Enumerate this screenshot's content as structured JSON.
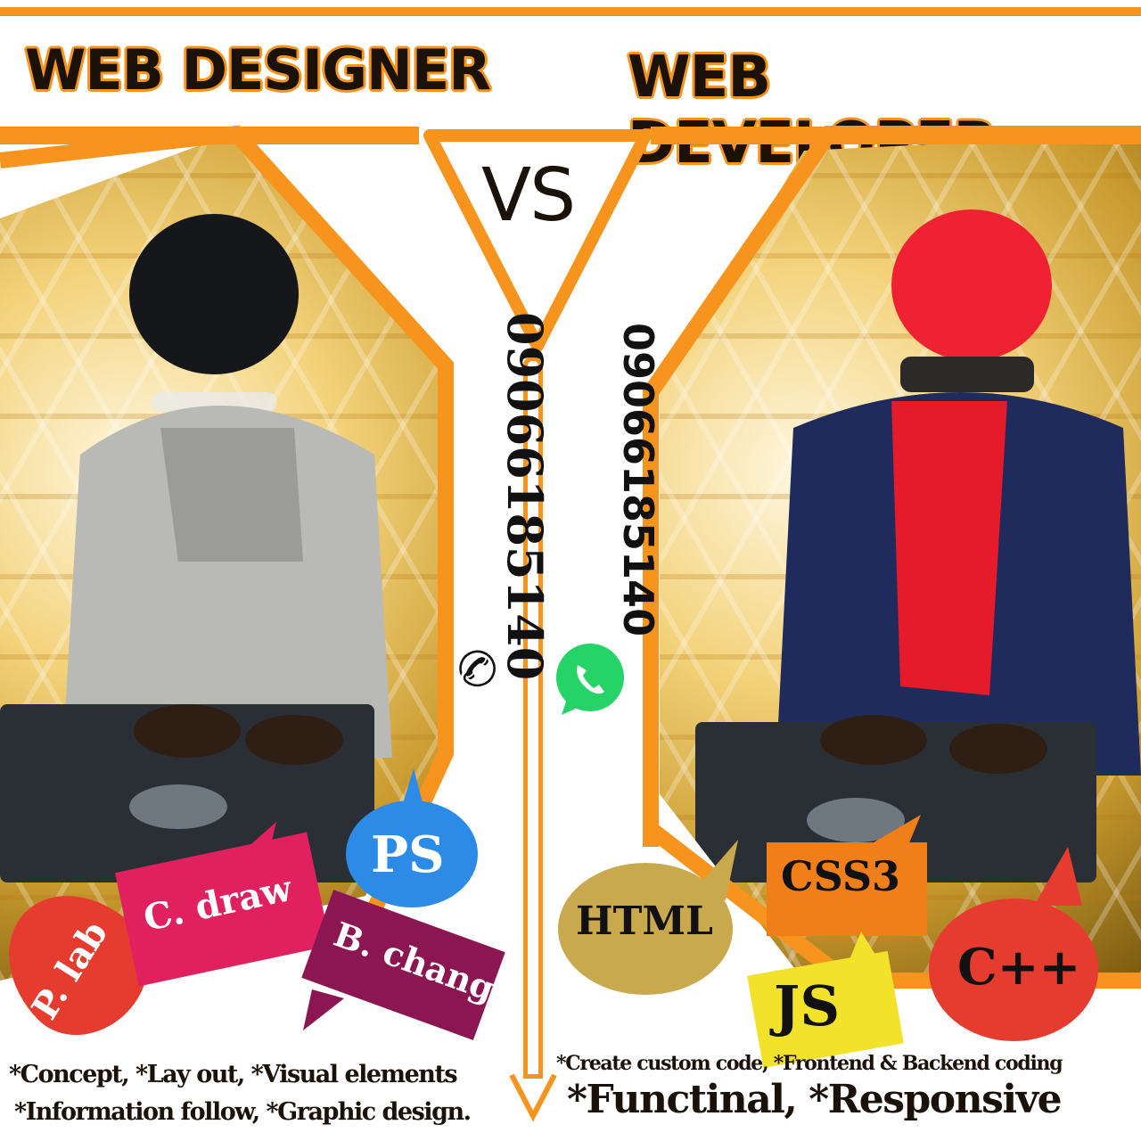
{
  "header": {
    "left_title": "WEB DESIGNER",
    "right_title": "WEB DEVELOPER",
    "vs_label": "VS"
  },
  "contact": {
    "phone_left": "09066185140",
    "phone_right": "09066185140"
  },
  "designer_badges": {
    "p_lab": "P. lab",
    "c_draw": "C. draw",
    "ps": "PS",
    "b_change": "B. change"
  },
  "developer_badges": {
    "html": "HTML",
    "css3": "CSS3",
    "js": "JS",
    "cpp": "C++"
  },
  "designer_skills": {
    "line1": "*Concept, *Lay out,  *Visual elements",
    "line2": "*Information follow, *Graphic design."
  },
  "developer_skills": {
    "line1": "*Create custom code, *Frontend & Backend coding",
    "line2": "*Functinal, *Responsive"
  },
  "colors": {
    "accent": "#f7941d",
    "text": "#1a1208",
    "p_lab": "#e53c2f",
    "c_draw": "#e0205f",
    "ps": "#2b8be6",
    "b_change": "#8c1652",
    "html": "#c9a94d",
    "css3": "#f07f1a",
    "js": "#f2e22a",
    "cpp": "#e53c2f",
    "whatsapp": "#25d366"
  },
  "icons": {
    "phone": "phone-icon",
    "whatsapp": "whatsapp-icon"
  }
}
